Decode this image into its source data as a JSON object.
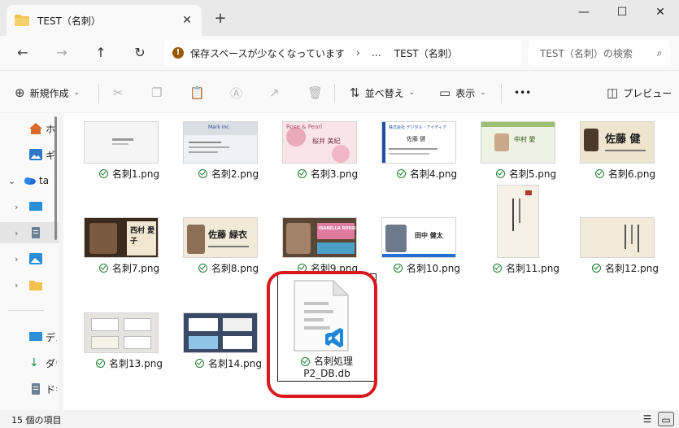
{
  "window": {
    "tab_title": "TEST（名刺）",
    "tab_close": "✕",
    "new_tab": "+",
    "minimize": "—",
    "maximize": "☐",
    "close": "✕"
  },
  "nav": {
    "back": "←",
    "forward": "→",
    "up": "↑",
    "refresh": "↻",
    "address_warning": "保存スペースが少なくなっています",
    "address_sep": "›",
    "address_more": "…",
    "address_folder": "TEST（名刺）",
    "search_placeholder": "TEST（名刺）の検索",
    "search_icon": "⌕"
  },
  "command_bar": {
    "new_label": "新規作成",
    "sort_label": "並べ替え",
    "view_label": "表示",
    "more": "•••",
    "preview_label": "プレビュー",
    "icons": [
      "plus-circle-icon",
      "cut-icon",
      "copy-icon",
      "paste-icon",
      "rename-icon",
      "share-icon",
      "delete-icon",
      "sort-icon",
      "view-icon",
      "preview-pane-icon"
    ]
  },
  "sidebar": {
    "items": [
      {
        "label": "ホーム",
        "icon": "home-icon"
      },
      {
        "label": "ギャラリー",
        "icon": "gallery-icon"
      },
      {
        "label": "ta",
        "icon": "onedrive-icon"
      },
      {
        "label": "",
        "icon": "desktop-icon"
      },
      {
        "label": "",
        "icon": "documents-icon"
      },
      {
        "label": "",
        "icon": "pictures-icon"
      },
      {
        "label": "",
        "icon": "folder-icon"
      },
      {
        "label": "デスクトップ",
        "icon": "desktop-icon"
      },
      {
        "label": "ダウンロード",
        "icon": "download-icon"
      },
      {
        "label": "ドキュメント",
        "icon": "documents-icon"
      }
    ]
  },
  "files": [
    {
      "name": "名刺1.png"
    },
    {
      "name": "名刺2.png"
    },
    {
      "name": "名刺3.png"
    },
    {
      "name": "名刺4.png"
    },
    {
      "name": "名刺5.png"
    },
    {
      "name": "名刺6.png"
    },
    {
      "name": "名刺7.png"
    },
    {
      "name": "名刺8.png"
    },
    {
      "name": "名刺9.png"
    },
    {
      "name": "名刺10.png"
    },
    {
      "name": "名刺11.png"
    },
    {
      "name": "名刺12.png"
    },
    {
      "name": "名刺13.png"
    },
    {
      "name": "名刺14.png"
    }
  ],
  "db_file": {
    "line1": "名刺処理",
    "line2": "P2_DB.db",
    "icon": "vscode-file-icon"
  },
  "thumb_text": {
    "t2_head": "Mark Inc",
    "t3_head": "Rose & Pearl",
    "t3_name": "桜井 美紀",
    "t4_head": "株式会社 デジタル・アイディア",
    "t4_name": "佐藤 健",
    "t5_name": "中村 愛",
    "t6_name": "佐藤 健",
    "t7_name": "西村 愛子",
    "t8_name": "佐藤 緑衣",
    "t9_name": "ISABELLA ROSSI",
    "t10_name": "田中 健太"
  },
  "status": {
    "count": "15 個の項目"
  },
  "colors": {
    "highlight": "#d9191d",
    "check": "#1e7d32",
    "vscode": "#1f86d8"
  }
}
